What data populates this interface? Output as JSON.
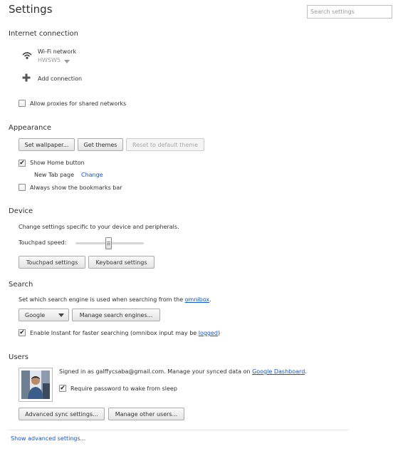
{
  "page": {
    "title": "Settings"
  },
  "search": {
    "placeholder": "Search settings"
  },
  "internet": {
    "title": "Internet connection",
    "network_label": "Wi-Fi network",
    "network_name": "HWSW5",
    "add_connection": "Add connection",
    "allow_proxies": "Allow proxies for shared networks",
    "allow_proxies_checked": false
  },
  "appearance": {
    "title": "Appearance",
    "set_wallpaper": "Set wallpaper...",
    "get_themes": "Get themes",
    "reset_theme": "Reset to default theme",
    "show_home": "Show Home button",
    "show_home_checked": true,
    "new_tab_label": "New Tab page",
    "change_link": "Change",
    "bookmarks_bar": "Always show the bookmarks bar",
    "bookmarks_bar_checked": false
  },
  "device": {
    "title": "Device",
    "description": "Change settings specific to your device and peripherals.",
    "touchpad_speed_label": "Touchpad speed:",
    "touchpad_speed_value": 0.5,
    "touchpad_settings": "Touchpad settings",
    "keyboard_settings": "Keyboard settings"
  },
  "search_section": {
    "title": "Search",
    "description_prefix": "Set which search engine is used when searching from the ",
    "omnibox_link": "omnibox",
    "description_suffix": ".",
    "engine_selected": "Google",
    "manage_engines": "Manage search engines...",
    "instant_prefix": "Enable Instant for faster searching (omnibox input may be ",
    "logged_link": "logged",
    "instant_suffix": ")",
    "instant_checked": true
  },
  "users": {
    "title": "Users",
    "signed_in_prefix": "Signed in as galffycsaba@gmail.com. Manage your synced data on ",
    "dashboard_link": "Google Dashboard",
    "signed_in_suffix": ".",
    "require_password": "Require password to wake from sleep",
    "require_password_checked": true,
    "advanced_sync": "Advanced sync settings...",
    "manage_users": "Manage other users..."
  },
  "footer": {
    "show_advanced": "Show advanced settings..."
  },
  "icons": {
    "wifi": "wifi-icon",
    "add": "plus-icon",
    "dropdown": "chevron-down-icon",
    "checkmark": "checkmark-icon",
    "avatar": "user-avatar"
  },
  "colors": {
    "link": "#1155cc",
    "text": "#303030",
    "muted": "#999999"
  }
}
